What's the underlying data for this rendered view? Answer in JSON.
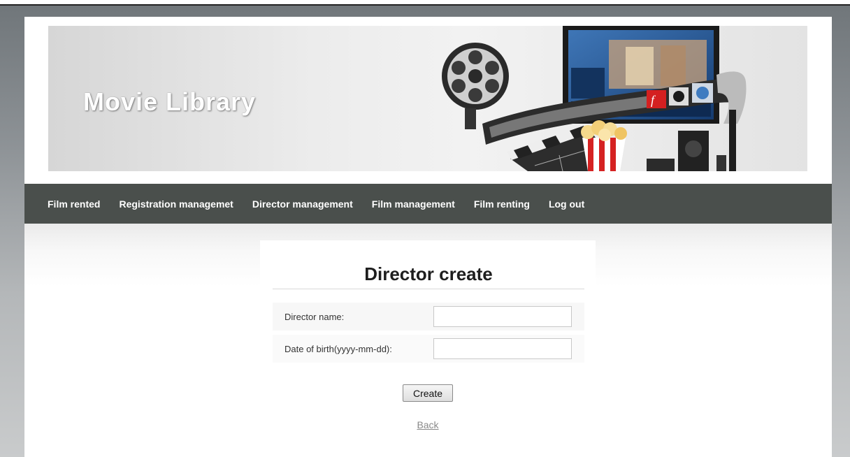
{
  "header": {
    "brand": "Movie Library"
  },
  "nav": {
    "items": [
      {
        "label": "Film rented"
      },
      {
        "label": "Registration managemet"
      },
      {
        "label": "Director management"
      },
      {
        "label": "Film management"
      },
      {
        "label": "Film renting"
      },
      {
        "label": "Log out"
      }
    ]
  },
  "form": {
    "title": "Director create",
    "fields": [
      {
        "label": "Director name:",
        "value": ""
      },
      {
        "label": "Date of birth(yyyy-mm-dd):",
        "value": ""
      }
    ],
    "submit_label": "Create",
    "back_label": "Back"
  },
  "colors": {
    "nav_bg": "#4a4f4c",
    "nav_text": "#ffffff",
    "link": "#8a8a8a"
  },
  "icons": [
    "film-reel-icon",
    "clapperboard-icon",
    "popcorn-icon",
    "tv-screen-icon",
    "film-strip-icon",
    "speaker-icon"
  ]
}
